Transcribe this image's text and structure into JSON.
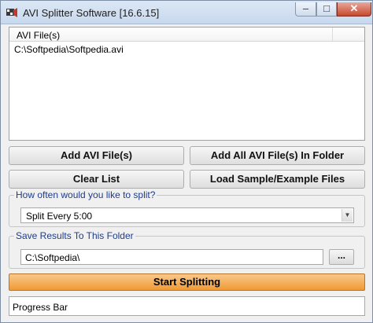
{
  "window": {
    "title": "AVI Splitter Software [16.6.15]"
  },
  "titlebar": {
    "minimize": "–",
    "maximize": "□",
    "close": "✕"
  },
  "file_list": {
    "column_header": "AVI File(s)",
    "rows": [
      "C:\\Softpedia\\Softpedia.avi"
    ]
  },
  "buttons": {
    "add_files": "Add AVI File(s)",
    "add_all_in_folder": "Add All AVI File(s) In Folder",
    "clear_list": "Clear List",
    "load_samples": "Load Sample/Example Files"
  },
  "split": {
    "label": "How often would you like to split?",
    "selected": "Split Every 5:00"
  },
  "output": {
    "label": "Save Results To This Folder",
    "folder": "C:\\Softpedia\\",
    "browse": "..."
  },
  "start_button": "Start Splitting",
  "progress": {
    "text": "Progress Bar"
  }
}
